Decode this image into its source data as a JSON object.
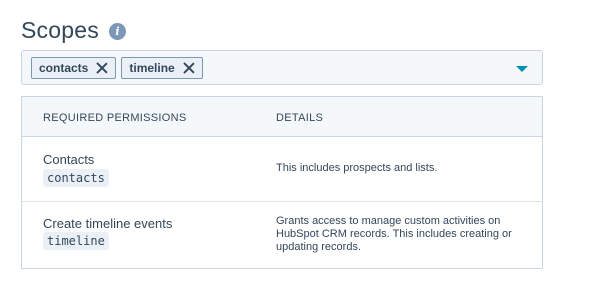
{
  "header": {
    "title": "Scopes",
    "info_icon": "info-icon",
    "info_glyph": "i"
  },
  "scope_select": {
    "tags": [
      {
        "label": "contacts"
      },
      {
        "label": "timeline"
      }
    ],
    "caret_icon": "chevron-down-icon",
    "accent_color": "#0091ae"
  },
  "table": {
    "columns": [
      "REQUIRED PERMISSIONS",
      "DETAILS"
    ],
    "rows": [
      {
        "name": "Contacts",
        "code": "contacts",
        "details": "This includes prospects and lists."
      },
      {
        "name": "Create timeline events",
        "code": "timeline",
        "details": "Grants access to manage custom activities on HubSpot CRM records. This includes creating or updating records."
      }
    ]
  }
}
